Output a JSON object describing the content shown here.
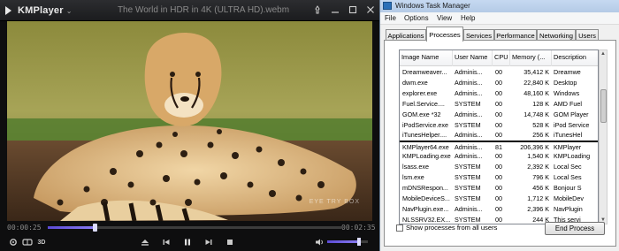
{
  "kmplayer": {
    "app_name": "KMPlayer",
    "file_title": "The World in HDR in 4K (ULTRA HD).webm",
    "watermark": "EYE TRY BOX",
    "time_elapsed": "00:00:25",
    "time_total": "00:02:35",
    "seek_fraction": 0.161,
    "volume_fraction": 0.78,
    "icons": {
      "logo": "kmplayer-logo-icon",
      "pin": "pin-icon",
      "minimize": "minimize-icon",
      "maximize": "maximize-icon",
      "close": "close-icon",
      "settings": "settings-icon",
      "vr": "vr-glasses-icon",
      "three_d": "3d-icon",
      "eject": "eject-icon",
      "prev": "previous-icon",
      "pause": "pause-icon",
      "next": "next-icon",
      "stop": "stop-icon",
      "volume": "volume-icon"
    }
  },
  "taskmanager": {
    "window_title": "Windows Task Manager",
    "menus": [
      "File",
      "Options",
      "View",
      "Help"
    ],
    "tabs": [
      "Applications",
      "Processes",
      "Services",
      "Performance",
      "Networking",
      "Users"
    ],
    "active_tab": "Processes",
    "columns": [
      "Image Name",
      "User Name",
      "CPU",
      "Memory (...",
      "Description"
    ],
    "rows": [
      {
        "name": "Dreamweaver...",
        "user": "Adminis...",
        "cpu": "00",
        "mem": "35,412 K",
        "desc": "Dreamwe"
      },
      {
        "name": "dwm.exe",
        "user": "Adminis...",
        "cpu": "00",
        "mem": "22,840 K",
        "desc": "Desktop"
      },
      {
        "name": "explorer.exe",
        "user": "Adminis...",
        "cpu": "00",
        "mem": "48,160 K",
        "desc": "Windows"
      },
      {
        "name": "Fuel.Service....",
        "user": "SYSTEM",
        "cpu": "00",
        "mem": "128 K",
        "desc": "AMD Fuel"
      },
      {
        "name": "GOM.exe *32",
        "user": "Adminis...",
        "cpu": "00",
        "mem": "14,748 K",
        "desc": "GOM Player"
      },
      {
        "name": "iPodService.exe",
        "user": "SYSTEM",
        "cpu": "00",
        "mem": "528 K",
        "desc": "iPod Service"
      },
      {
        "name": "iTunesHelper....",
        "user": "Adminis...",
        "cpu": "00",
        "mem": "256 K",
        "desc": "iTunesHel"
      },
      {
        "name": "KMPlayer64.exe",
        "user": "Adminis...",
        "cpu": "81",
        "mem": "206,396 K",
        "desc": "KMPlayer"
      },
      {
        "name": "KMPLoading.exe",
        "user": "Adminis...",
        "cpu": "00",
        "mem": "1,540 K",
        "desc": "KMPLoading"
      },
      {
        "name": "lsass.exe",
        "user": "SYSTEM",
        "cpu": "00",
        "mem": "2,392 K",
        "desc": "Local Sec"
      },
      {
        "name": "lsm.exe",
        "user": "SYSTEM",
        "cpu": "00",
        "mem": "796 K",
        "desc": "Local Ses"
      },
      {
        "name": "mDNSRespon...",
        "user": "SYSTEM",
        "cpu": "00",
        "mem": "456 K",
        "desc": "Bonjour S"
      },
      {
        "name": "MobileDeviceS...",
        "user": "SYSTEM",
        "cpu": "00",
        "mem": "1,712 K",
        "desc": "MobileDev"
      },
      {
        "name": "NavPlugin.exe...",
        "user": "Adminis...",
        "cpu": "00",
        "mem": "2,396 K",
        "desc": "NavPlugin"
      },
      {
        "name": "NLSSRV32.EX...",
        "user": "SYSTEM",
        "cpu": "00",
        "mem": "244 K",
        "desc": "This servi"
      }
    ],
    "selected_row": 7,
    "show_all_label": "Show processes from all users",
    "end_process_label": "End Process",
    "icons": {
      "app": "task-manager-icon",
      "checkbox": "checkbox-icon",
      "scroll_up": "scroll-up-icon",
      "scroll_down": "scroll-down-icon"
    },
    "colors": {
      "selection_border": "#000000",
      "title_bar": "#c6d9f1"
    }
  }
}
